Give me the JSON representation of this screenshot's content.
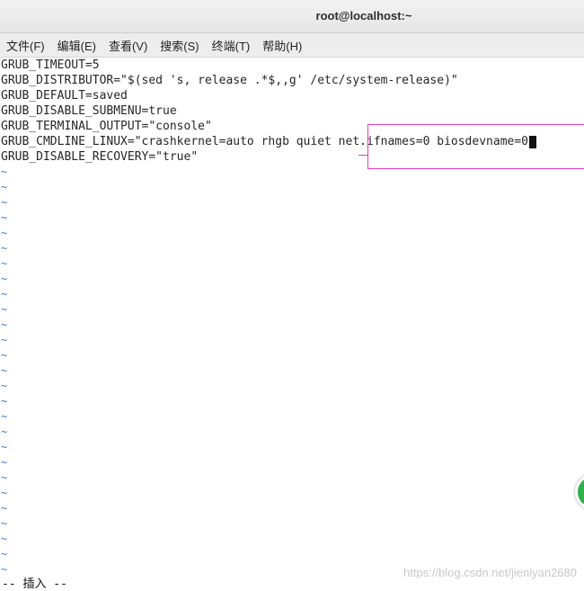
{
  "window": {
    "title": "root@localhost:~"
  },
  "menu": [
    {
      "label": "文件(F)"
    },
    {
      "label": "编辑(E)"
    },
    {
      "label": "查看(V)"
    },
    {
      "label": "搜索(S)"
    },
    {
      "label": "终端(T)"
    },
    {
      "label": "帮助(H)"
    }
  ],
  "editor": {
    "lines": [
      "GRUB_TIMEOUT=5",
      "GRUB_DISTRIBUTOR=\"$(sed 's, release .*$,,g' /etc/system-release)\"",
      "GRUB_DEFAULT=saved",
      "GRUB_DISABLE_SUBMENU=true",
      "GRUB_TERMINAL_OUTPUT=\"console\"",
      "GRUB_CMDLINE_LINUX=\"crashkernel=auto rhgb quiet net.ifnames=0 biosdevname=0",
      "GRUB_DISABLE_RECOVERY=\"true\""
    ],
    "tilde": "~",
    "tilde_count": 27
  },
  "status": {
    "mode": "-- 插入 --"
  },
  "watermark": "https://blog.csdn.net/jienlyan2680",
  "colors": {
    "highlight_box": "#e040c0",
    "tilde": "#3a7bd5",
    "fab": "#2fb24a"
  }
}
